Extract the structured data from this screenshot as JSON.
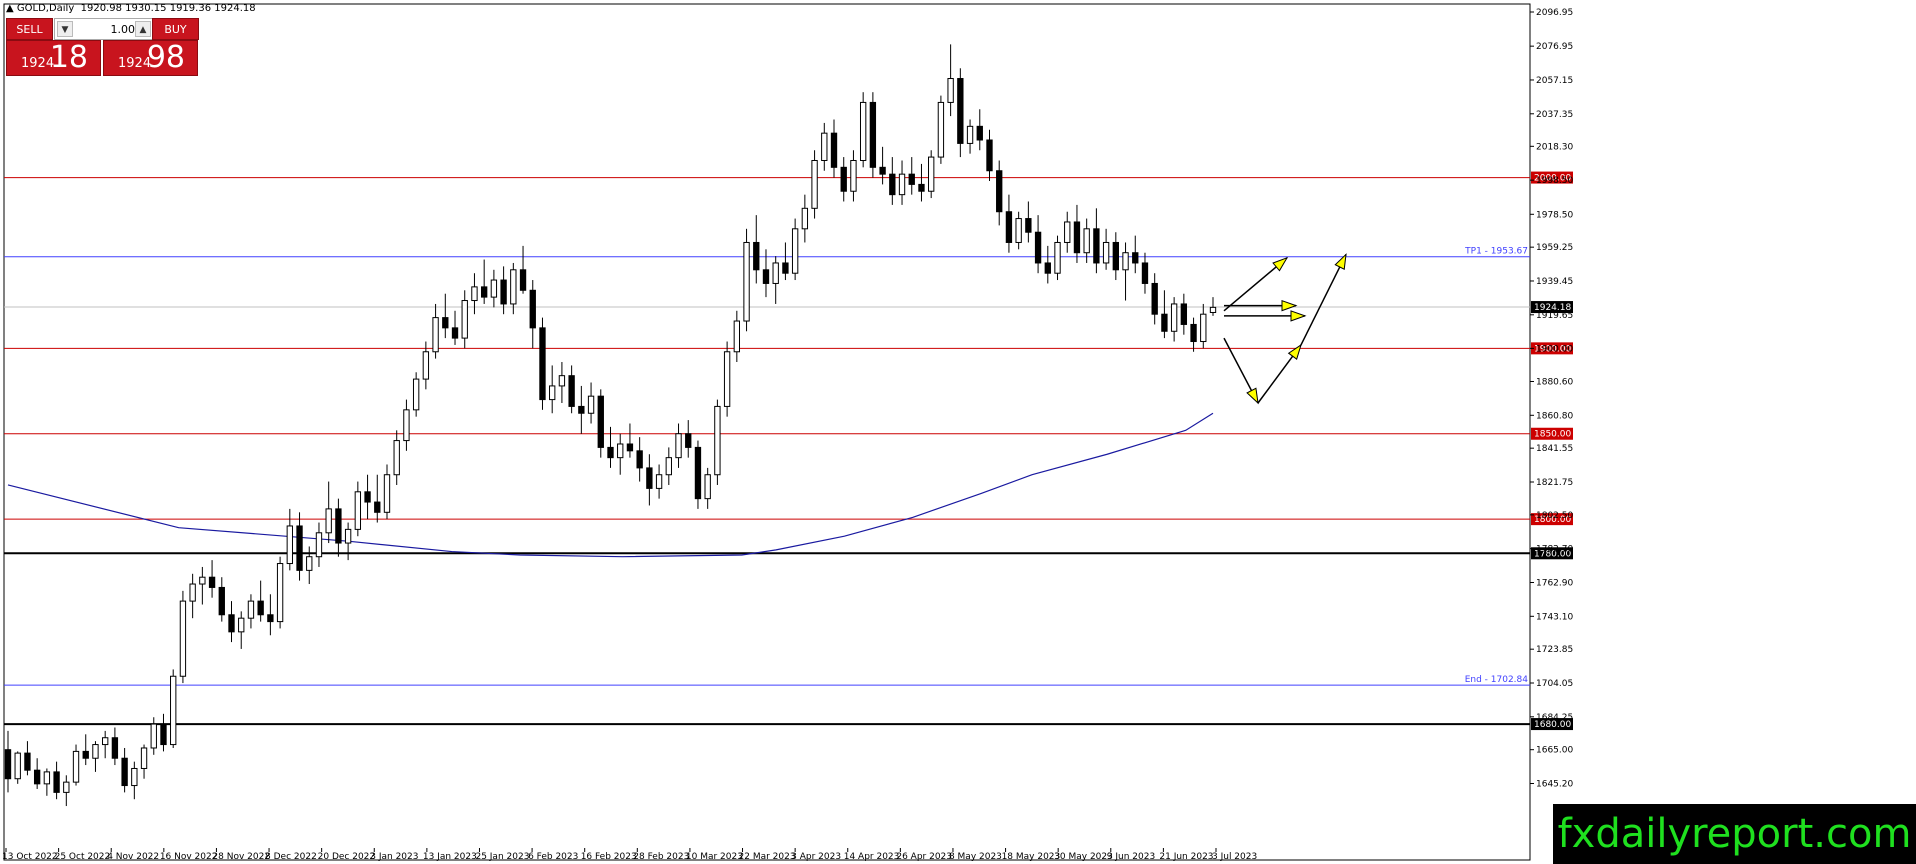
{
  "header": {
    "symbol": "GOLD,Daily",
    "open": "1920.98",
    "high": "1930.15",
    "low": "1919.36",
    "close": "1924.18"
  },
  "trade_panel": {
    "sell_label": "SELL",
    "buy_label": "BUY",
    "lot": "1.00",
    "down": "▼",
    "up": "▲",
    "sell_small": "1924",
    "sell_big": "18",
    "buy_small": "1924",
    "buy_big": "98"
  },
  "colors": {
    "panel": "#c8141e",
    "level": "#cc0000",
    "trendline": "#1a1aa0",
    "tp_line": "#4040ff",
    "arrow": "#ffff00",
    "logo_bg": "#000000",
    "logo_text": "#1fe01f"
  },
  "logo": "fxdailyreport.com",
  "chart_data": {
    "type": "candlestick",
    "symbol": "GOLD",
    "timeframe": "Daily",
    "ylim": [
      1625,
      2096.95
    ],
    "y_ticks": [
      "2096.95",
      "2076.95",
      "2057.15",
      "2037.35",
      "2018.30",
      "1998.50",
      "1978.50",
      "1959.25",
      "1939.45",
      "1919.65",
      "1900.00",
      "1880.60",
      "1860.80",
      "1841.55",
      "1821.75",
      "1802.50",
      "1782.70",
      "1762.90",
      "1743.10",
      "1723.85",
      "1704.05",
      "1684.25",
      "1665.00",
      "1645.20"
    ],
    "x_ticks": [
      "13 Oct 2022",
      "25 Oct 2022",
      "4 Nov 2022",
      "16 Nov 2022",
      "28 Nov 2022",
      "8 Dec 2022",
      "20 Dec 2022",
      "3 Jan 2023",
      "13 Jan 2023",
      "25 Jan 2023",
      "6 Feb 2023",
      "16 Feb 2023",
      "28 Feb 2023",
      "10 Mar 2023",
      "22 Mar 2023",
      "3 Apr 2023",
      "14 Apr 2023",
      "26 Apr 2023",
      "8 May 2023",
      "18 May 2023",
      "30 May 2023",
      "9 Jun 2023",
      "21 Jun 2023",
      "3 Jul 2023"
    ],
    "current_price": "1924.18",
    "horizontal_levels": [
      {
        "value": 2000,
        "label": "2000.00",
        "style": "red"
      },
      {
        "value": 1953.67,
        "label": "TP1 - 1953.67",
        "style": "blue"
      },
      {
        "value": 1924.18,
        "label": "1924.18",
        "style": "current"
      },
      {
        "value": 1900,
        "label": "1900.00",
        "style": "red"
      },
      {
        "value": 1850,
        "label": "1850.00",
        "style": "red"
      },
      {
        "value": 1800,
        "label": "1800.00",
        "style": "red"
      },
      {
        "value": 1780,
        "label": "1780.00",
        "style": "black"
      },
      {
        "value": 1702.84,
        "label": "End - 1702.84",
        "style": "blue"
      },
      {
        "value": 1680,
        "label": "1680.00",
        "style": "black"
      }
    ],
    "moving_average": [
      [
        0,
        1820
      ],
      [
        50,
        1795
      ],
      [
        100,
        1787
      ],
      [
        130,
        1781
      ],
      [
        150,
        1779
      ],
      [
        180,
        1778
      ],
      [
        215,
        1779
      ],
      [
        225,
        1782
      ],
      [
        245,
        1790
      ],
      [
        265,
        1801
      ],
      [
        285,
        1815
      ],
      [
        300,
        1826
      ],
      [
        322,
        1838
      ],
      [
        345,
        1852
      ],
      [
        353,
        1862
      ]
    ],
    "candles": [
      [
        1665,
        1676,
        1640,
        1648
      ],
      [
        1648,
        1664,
        1645,
        1663
      ],
      [
        1663,
        1670,
        1650,
        1653
      ],
      [
        1653,
        1660,
        1642,
        1645
      ],
      [
        1645,
        1654,
        1638,
        1652
      ],
      [
        1652,
        1658,
        1636,
        1640
      ],
      [
        1640,
        1650,
        1632,
        1646
      ],
      [
        1646,
        1668,
        1644,
        1664
      ],
      [
        1664,
        1674,
        1656,
        1660
      ],
      [
        1660,
        1670,
        1652,
        1668
      ],
      [
        1668,
        1676,
        1660,
        1672
      ],
      [
        1672,
        1678,
        1656,
        1660
      ],
      [
        1660,
        1666,
        1640,
        1644
      ],
      [
        1644,
        1658,
        1636,
        1654
      ],
      [
        1654,
        1668,
        1648,
        1666
      ],
      [
        1666,
        1684,
        1662,
        1680
      ],
      [
        1680,
        1686,
        1664,
        1668
      ],
      [
        1668,
        1712,
        1666,
        1708
      ],
      [
        1708,
        1758,
        1704,
        1752
      ],
      [
        1752,
        1768,
        1742,
        1762
      ],
      [
        1762,
        1772,
        1750,
        1766
      ],
      [
        1766,
        1776,
        1754,
        1760
      ],
      [
        1760,
        1766,
        1740,
        1744
      ],
      [
        1744,
        1752,
        1728,
        1734
      ],
      [
        1734,
        1746,
        1724,
        1742
      ],
      [
        1742,
        1756,
        1736,
        1752
      ],
      [
        1752,
        1764,
        1740,
        1744
      ],
      [
        1744,
        1756,
        1732,
        1740
      ],
      [
        1740,
        1778,
        1736,
        1774
      ],
      [
        1774,
        1806,
        1770,
        1796
      ],
      [
        1796,
        1804,
        1764,
        1770
      ],
      [
        1770,
        1784,
        1762,
        1778
      ],
      [
        1778,
        1798,
        1772,
        1792
      ],
      [
        1792,
        1822,
        1786,
        1806
      ],
      [
        1806,
        1812,
        1778,
        1786
      ],
      [
        1786,
        1798,
        1776,
        1794
      ],
      [
        1794,
        1822,
        1790,
        1816
      ],
      [
        1816,
        1826,
        1800,
        1810
      ],
      [
        1810,
        1826,
        1798,
        1804
      ],
      [
        1804,
        1832,
        1800,
        1826
      ],
      [
        1826,
        1852,
        1820,
        1846
      ],
      [
        1846,
        1870,
        1840,
        1864
      ],
      [
        1864,
        1886,
        1860,
        1882
      ],
      [
        1882,
        1904,
        1876,
        1898
      ],
      [
        1898,
        1926,
        1894,
        1918
      ],
      [
        1918,
        1932,
        1906,
        1912
      ],
      [
        1912,
        1922,
        1902,
        1906
      ],
      [
        1906,
        1934,
        1900,
        1928
      ],
      [
        1928,
        1944,
        1920,
        1936
      ],
      [
        1936,
        1952,
        1926,
        1930
      ],
      [
        1930,
        1946,
        1924,
        1940
      ],
      [
        1940,
        1948,
        1920,
        1926
      ],
      [
        1926,
        1950,
        1920,
        1946
      ],
      [
        1946,
        1960,
        1932,
        1934
      ],
      [
        1934,
        1940,
        1900,
        1912
      ],
      [
        1912,
        1918,
        1864,
        1870
      ],
      [
        1870,
        1890,
        1862,
        1878
      ],
      [
        1878,
        1892,
        1868,
        1884
      ],
      [
        1884,
        1890,
        1862,
        1866
      ],
      [
        1866,
        1878,
        1850,
        1862
      ],
      [
        1862,
        1880,
        1856,
        1872
      ],
      [
        1872,
        1876,
        1836,
        1842
      ],
      [
        1842,
        1854,
        1830,
        1836
      ],
      [
        1836,
        1850,
        1826,
        1844
      ],
      [
        1844,
        1856,
        1836,
        1840
      ],
      [
        1840,
        1848,
        1822,
        1830
      ],
      [
        1830,
        1838,
        1808,
        1818
      ],
      [
        1818,
        1832,
        1812,
        1826
      ],
      [
        1826,
        1842,
        1820,
        1836
      ],
      [
        1836,
        1856,
        1830,
        1850
      ],
      [
        1850,
        1858,
        1836,
        1842
      ],
      [
        1842,
        1846,
        1806,
        1812
      ],
      [
        1812,
        1830,
        1806,
        1826
      ],
      [
        1826,
        1870,
        1820,
        1866
      ],
      [
        1866,
        1904,
        1860,
        1898
      ],
      [
        1898,
        1922,
        1892,
        1916
      ],
      [
        1916,
        1970,
        1910,
        1962
      ],
      [
        1962,
        1978,
        1938,
        1946
      ],
      [
        1946,
        1958,
        1930,
        1938
      ],
      [
        1938,
        1954,
        1926,
        1950
      ],
      [
        1950,
        1962,
        1940,
        1944
      ],
      [
        1944,
        1976,
        1940,
        1970
      ],
      [
        1970,
        1990,
        1962,
        1982
      ],
      [
        1982,
        2016,
        1976,
        2010
      ],
      [
        2010,
        2032,
        2004,
        2026
      ],
      [
        2026,
        2034,
        2000,
        2006
      ],
      [
        2006,
        2012,
        1986,
        1992
      ],
      [
        1992,
        2016,
        1986,
        2010
      ],
      [
        2010,
        2050,
        2006,
        2044
      ],
      [
        2044,
        2050,
        2000,
        2006
      ],
      [
        2006,
        2018,
        1996,
        2002
      ],
      [
        2002,
        2012,
        1984,
        1990
      ],
      [
        1990,
        2010,
        1984,
        2002
      ],
      [
        2002,
        2012,
        1990,
        1996
      ],
      [
        1996,
        2008,
        1986,
        1992
      ],
      [
        1992,
        2016,
        1988,
        2012
      ],
      [
        2012,
        2048,
        2008,
        2044
      ],
      [
        2044,
        2078,
        2036,
        2058
      ],
      [
        2058,
        2064,
        2012,
        2020
      ],
      [
        2020,
        2034,
        2014,
        2030
      ],
      [
        2030,
        2040,
        2016,
        2022
      ],
      [
        2022,
        2028,
        1998,
        2004
      ],
      [
        2004,
        2010,
        1972,
        1980
      ],
      [
        1980,
        1990,
        1956,
        1962
      ],
      [
        1962,
        1980,
        1958,
        1976
      ],
      [
        1976,
        1986,
        1962,
        1968
      ],
      [
        1968,
        1978,
        1944,
        1950
      ],
      [
        1950,
        1960,
        1938,
        1944
      ],
      [
        1944,
        1966,
        1940,
        1962
      ],
      [
        1962,
        1980,
        1956,
        1974
      ],
      [
        1974,
        1984,
        1950,
        1956
      ],
      [
        1956,
        1976,
        1950,
        1970
      ],
      [
        1970,
        1982,
        1944,
        1950
      ],
      [
        1950,
        1970,
        1946,
        1962
      ],
      [
        1962,
        1968,
        1940,
        1946
      ],
      [
        1946,
        1962,
        1928,
        1956
      ],
      [
        1956,
        1966,
        1944,
        1950
      ],
      [
        1950,
        1956,
        1932,
        1938
      ],
      [
        1938,
        1944,
        1914,
        1920
      ],
      [
        1920,
        1934,
        1906,
        1910
      ],
      [
        1910,
        1930,
        1904,
        1926
      ],
      [
        1926,
        1932,
        1908,
        1914
      ],
      [
        1914,
        1918,
        1898,
        1904
      ],
      [
        1904,
        1926,
        1900,
        1920
      ],
      [
        1921,
        1930,
        1919,
        1924
      ]
    ]
  },
  "arrows": {
    "color": "#ffff00"
  }
}
